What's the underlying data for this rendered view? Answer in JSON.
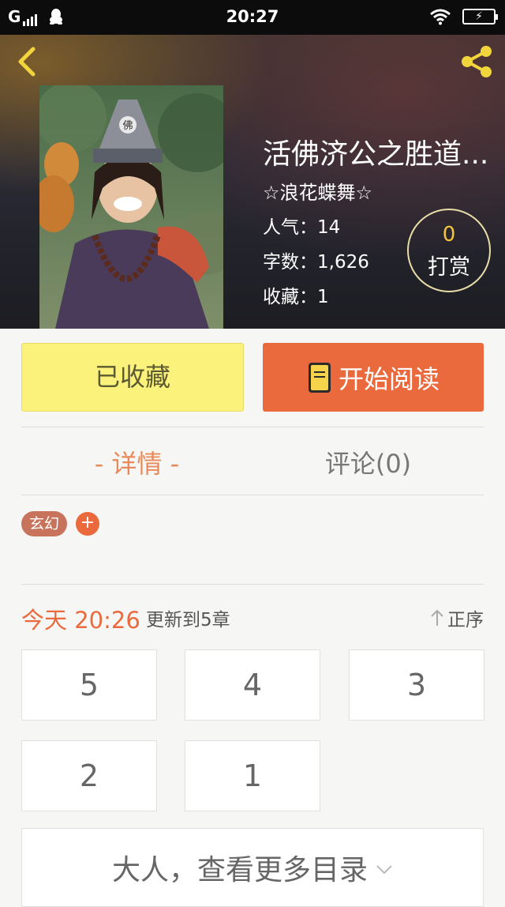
{
  "status_bar": {
    "carrier": "G",
    "time": "20:27"
  },
  "book": {
    "title": "活佛济公之胜道...",
    "author": "☆浪花蝶舞☆",
    "stats": [
      {
        "label": "人气：",
        "value": "14"
      },
      {
        "label": "字数：",
        "value": "1,626"
      },
      {
        "label": "收藏：",
        "value": "1"
      }
    ],
    "tip": {
      "count": "0",
      "label": "打赏"
    }
  },
  "actions": {
    "collect_label": "已收藏",
    "read_label": "开始阅读"
  },
  "tabs": [
    {
      "label": "- 详情 -",
      "active": true
    },
    {
      "label": "评论(0)",
      "active": false
    }
  ],
  "tags": [
    {
      "label": "玄幻"
    }
  ],
  "tag_add_label": "+",
  "update": {
    "time": "今天 20:26",
    "text": "更新到5章",
    "sort_label": "正序"
  },
  "chapters": [
    "5",
    "4",
    "3",
    "2",
    "1"
  ],
  "more_label": "大人，查看更多目录",
  "colors": {
    "accent": "#ea6a3d",
    "collect_bg": "#fbf27c",
    "tip_count": "#f4c63d",
    "share_icon": "#f2d53c"
  },
  "icons": [
    "back-arrow-icon",
    "share-icon",
    "book-icon",
    "sort-up-arrow-icon",
    "chevron-down-icon",
    "wifi-icon",
    "battery-icon",
    "qq-icon",
    "signal-icon"
  ]
}
